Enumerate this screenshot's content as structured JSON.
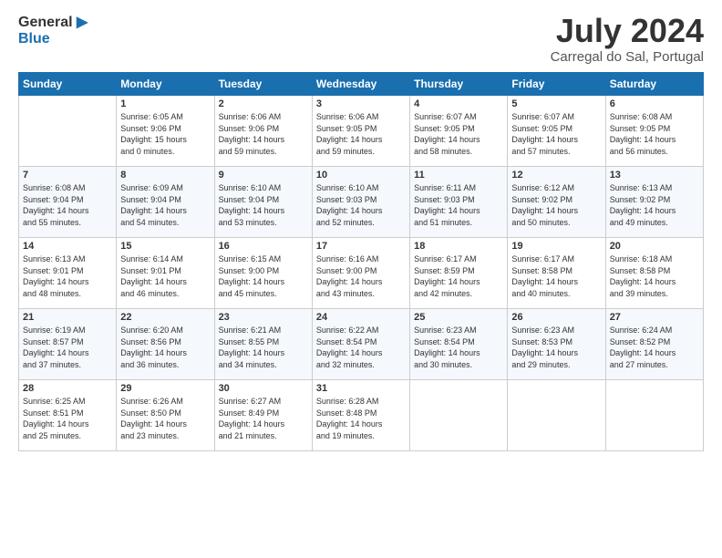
{
  "header": {
    "logo_line1": "General",
    "logo_line2": "Blue",
    "month": "July 2024",
    "location": "Carregal do Sal, Portugal"
  },
  "days_of_week": [
    "Sunday",
    "Monday",
    "Tuesday",
    "Wednesday",
    "Thursday",
    "Friday",
    "Saturday"
  ],
  "weeks": [
    [
      {
        "day": "",
        "info": ""
      },
      {
        "day": "1",
        "info": "Sunrise: 6:05 AM\nSunset: 9:06 PM\nDaylight: 15 hours\nand 0 minutes."
      },
      {
        "day": "2",
        "info": "Sunrise: 6:06 AM\nSunset: 9:06 PM\nDaylight: 14 hours\nand 59 minutes."
      },
      {
        "day": "3",
        "info": "Sunrise: 6:06 AM\nSunset: 9:05 PM\nDaylight: 14 hours\nand 59 minutes."
      },
      {
        "day": "4",
        "info": "Sunrise: 6:07 AM\nSunset: 9:05 PM\nDaylight: 14 hours\nand 58 minutes."
      },
      {
        "day": "5",
        "info": "Sunrise: 6:07 AM\nSunset: 9:05 PM\nDaylight: 14 hours\nand 57 minutes."
      },
      {
        "day": "6",
        "info": "Sunrise: 6:08 AM\nSunset: 9:05 PM\nDaylight: 14 hours\nand 56 minutes."
      }
    ],
    [
      {
        "day": "7",
        "info": "Sunrise: 6:08 AM\nSunset: 9:04 PM\nDaylight: 14 hours\nand 55 minutes."
      },
      {
        "day": "8",
        "info": "Sunrise: 6:09 AM\nSunset: 9:04 PM\nDaylight: 14 hours\nand 54 minutes."
      },
      {
        "day": "9",
        "info": "Sunrise: 6:10 AM\nSunset: 9:04 PM\nDaylight: 14 hours\nand 53 minutes."
      },
      {
        "day": "10",
        "info": "Sunrise: 6:10 AM\nSunset: 9:03 PM\nDaylight: 14 hours\nand 52 minutes."
      },
      {
        "day": "11",
        "info": "Sunrise: 6:11 AM\nSunset: 9:03 PM\nDaylight: 14 hours\nand 51 minutes."
      },
      {
        "day": "12",
        "info": "Sunrise: 6:12 AM\nSunset: 9:02 PM\nDaylight: 14 hours\nand 50 minutes."
      },
      {
        "day": "13",
        "info": "Sunrise: 6:13 AM\nSunset: 9:02 PM\nDaylight: 14 hours\nand 49 minutes."
      }
    ],
    [
      {
        "day": "14",
        "info": "Sunrise: 6:13 AM\nSunset: 9:01 PM\nDaylight: 14 hours\nand 48 minutes."
      },
      {
        "day": "15",
        "info": "Sunrise: 6:14 AM\nSunset: 9:01 PM\nDaylight: 14 hours\nand 46 minutes."
      },
      {
        "day": "16",
        "info": "Sunrise: 6:15 AM\nSunset: 9:00 PM\nDaylight: 14 hours\nand 45 minutes."
      },
      {
        "day": "17",
        "info": "Sunrise: 6:16 AM\nSunset: 9:00 PM\nDaylight: 14 hours\nand 43 minutes."
      },
      {
        "day": "18",
        "info": "Sunrise: 6:17 AM\nSunset: 8:59 PM\nDaylight: 14 hours\nand 42 minutes."
      },
      {
        "day": "19",
        "info": "Sunrise: 6:17 AM\nSunset: 8:58 PM\nDaylight: 14 hours\nand 40 minutes."
      },
      {
        "day": "20",
        "info": "Sunrise: 6:18 AM\nSunset: 8:58 PM\nDaylight: 14 hours\nand 39 minutes."
      }
    ],
    [
      {
        "day": "21",
        "info": "Sunrise: 6:19 AM\nSunset: 8:57 PM\nDaylight: 14 hours\nand 37 minutes."
      },
      {
        "day": "22",
        "info": "Sunrise: 6:20 AM\nSunset: 8:56 PM\nDaylight: 14 hours\nand 36 minutes."
      },
      {
        "day": "23",
        "info": "Sunrise: 6:21 AM\nSunset: 8:55 PM\nDaylight: 14 hours\nand 34 minutes."
      },
      {
        "day": "24",
        "info": "Sunrise: 6:22 AM\nSunset: 8:54 PM\nDaylight: 14 hours\nand 32 minutes."
      },
      {
        "day": "25",
        "info": "Sunrise: 6:23 AM\nSunset: 8:54 PM\nDaylight: 14 hours\nand 30 minutes."
      },
      {
        "day": "26",
        "info": "Sunrise: 6:23 AM\nSunset: 8:53 PM\nDaylight: 14 hours\nand 29 minutes."
      },
      {
        "day": "27",
        "info": "Sunrise: 6:24 AM\nSunset: 8:52 PM\nDaylight: 14 hours\nand 27 minutes."
      }
    ],
    [
      {
        "day": "28",
        "info": "Sunrise: 6:25 AM\nSunset: 8:51 PM\nDaylight: 14 hours\nand 25 minutes."
      },
      {
        "day": "29",
        "info": "Sunrise: 6:26 AM\nSunset: 8:50 PM\nDaylight: 14 hours\nand 23 minutes."
      },
      {
        "day": "30",
        "info": "Sunrise: 6:27 AM\nSunset: 8:49 PM\nDaylight: 14 hours\nand 21 minutes."
      },
      {
        "day": "31",
        "info": "Sunrise: 6:28 AM\nSunset: 8:48 PM\nDaylight: 14 hours\nand 19 minutes."
      },
      {
        "day": "",
        "info": ""
      },
      {
        "day": "",
        "info": ""
      },
      {
        "day": "",
        "info": ""
      }
    ]
  ]
}
